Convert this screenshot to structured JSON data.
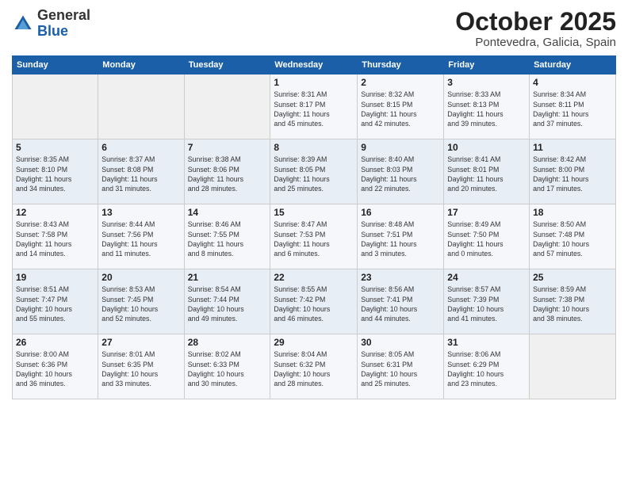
{
  "header": {
    "logo_general": "General",
    "logo_blue": "Blue",
    "month_title": "October 2025",
    "subtitle": "Pontevedra, Galicia, Spain"
  },
  "weekdays": [
    "Sunday",
    "Monday",
    "Tuesday",
    "Wednesday",
    "Thursday",
    "Friday",
    "Saturday"
  ],
  "weeks": [
    [
      {
        "day": "",
        "info": ""
      },
      {
        "day": "",
        "info": ""
      },
      {
        "day": "",
        "info": ""
      },
      {
        "day": "1",
        "info": "Sunrise: 8:31 AM\nSunset: 8:17 PM\nDaylight: 11 hours\nand 45 minutes."
      },
      {
        "day": "2",
        "info": "Sunrise: 8:32 AM\nSunset: 8:15 PM\nDaylight: 11 hours\nand 42 minutes."
      },
      {
        "day": "3",
        "info": "Sunrise: 8:33 AM\nSunset: 8:13 PM\nDaylight: 11 hours\nand 39 minutes."
      },
      {
        "day": "4",
        "info": "Sunrise: 8:34 AM\nSunset: 8:11 PM\nDaylight: 11 hours\nand 37 minutes."
      }
    ],
    [
      {
        "day": "5",
        "info": "Sunrise: 8:35 AM\nSunset: 8:10 PM\nDaylight: 11 hours\nand 34 minutes."
      },
      {
        "day": "6",
        "info": "Sunrise: 8:37 AM\nSunset: 8:08 PM\nDaylight: 11 hours\nand 31 minutes."
      },
      {
        "day": "7",
        "info": "Sunrise: 8:38 AM\nSunset: 8:06 PM\nDaylight: 11 hours\nand 28 minutes."
      },
      {
        "day": "8",
        "info": "Sunrise: 8:39 AM\nSunset: 8:05 PM\nDaylight: 11 hours\nand 25 minutes."
      },
      {
        "day": "9",
        "info": "Sunrise: 8:40 AM\nSunset: 8:03 PM\nDaylight: 11 hours\nand 22 minutes."
      },
      {
        "day": "10",
        "info": "Sunrise: 8:41 AM\nSunset: 8:01 PM\nDaylight: 11 hours\nand 20 minutes."
      },
      {
        "day": "11",
        "info": "Sunrise: 8:42 AM\nSunset: 8:00 PM\nDaylight: 11 hours\nand 17 minutes."
      }
    ],
    [
      {
        "day": "12",
        "info": "Sunrise: 8:43 AM\nSunset: 7:58 PM\nDaylight: 11 hours\nand 14 minutes."
      },
      {
        "day": "13",
        "info": "Sunrise: 8:44 AM\nSunset: 7:56 PM\nDaylight: 11 hours\nand 11 minutes."
      },
      {
        "day": "14",
        "info": "Sunrise: 8:46 AM\nSunset: 7:55 PM\nDaylight: 11 hours\nand 8 minutes."
      },
      {
        "day": "15",
        "info": "Sunrise: 8:47 AM\nSunset: 7:53 PM\nDaylight: 11 hours\nand 6 minutes."
      },
      {
        "day": "16",
        "info": "Sunrise: 8:48 AM\nSunset: 7:51 PM\nDaylight: 11 hours\nand 3 minutes."
      },
      {
        "day": "17",
        "info": "Sunrise: 8:49 AM\nSunset: 7:50 PM\nDaylight: 11 hours\nand 0 minutes."
      },
      {
        "day": "18",
        "info": "Sunrise: 8:50 AM\nSunset: 7:48 PM\nDaylight: 10 hours\nand 57 minutes."
      }
    ],
    [
      {
        "day": "19",
        "info": "Sunrise: 8:51 AM\nSunset: 7:47 PM\nDaylight: 10 hours\nand 55 minutes."
      },
      {
        "day": "20",
        "info": "Sunrise: 8:53 AM\nSunset: 7:45 PM\nDaylight: 10 hours\nand 52 minutes."
      },
      {
        "day": "21",
        "info": "Sunrise: 8:54 AM\nSunset: 7:44 PM\nDaylight: 10 hours\nand 49 minutes."
      },
      {
        "day": "22",
        "info": "Sunrise: 8:55 AM\nSunset: 7:42 PM\nDaylight: 10 hours\nand 46 minutes."
      },
      {
        "day": "23",
        "info": "Sunrise: 8:56 AM\nSunset: 7:41 PM\nDaylight: 10 hours\nand 44 minutes."
      },
      {
        "day": "24",
        "info": "Sunrise: 8:57 AM\nSunset: 7:39 PM\nDaylight: 10 hours\nand 41 minutes."
      },
      {
        "day": "25",
        "info": "Sunrise: 8:59 AM\nSunset: 7:38 PM\nDaylight: 10 hours\nand 38 minutes."
      }
    ],
    [
      {
        "day": "26",
        "info": "Sunrise: 8:00 AM\nSunset: 6:36 PM\nDaylight: 10 hours\nand 36 minutes."
      },
      {
        "day": "27",
        "info": "Sunrise: 8:01 AM\nSunset: 6:35 PM\nDaylight: 10 hours\nand 33 minutes."
      },
      {
        "day": "28",
        "info": "Sunrise: 8:02 AM\nSunset: 6:33 PM\nDaylight: 10 hours\nand 30 minutes."
      },
      {
        "day": "29",
        "info": "Sunrise: 8:04 AM\nSunset: 6:32 PM\nDaylight: 10 hours\nand 28 minutes."
      },
      {
        "day": "30",
        "info": "Sunrise: 8:05 AM\nSunset: 6:31 PM\nDaylight: 10 hours\nand 25 minutes."
      },
      {
        "day": "31",
        "info": "Sunrise: 8:06 AM\nSunset: 6:29 PM\nDaylight: 10 hours\nand 23 minutes."
      },
      {
        "day": "",
        "info": ""
      }
    ]
  ]
}
